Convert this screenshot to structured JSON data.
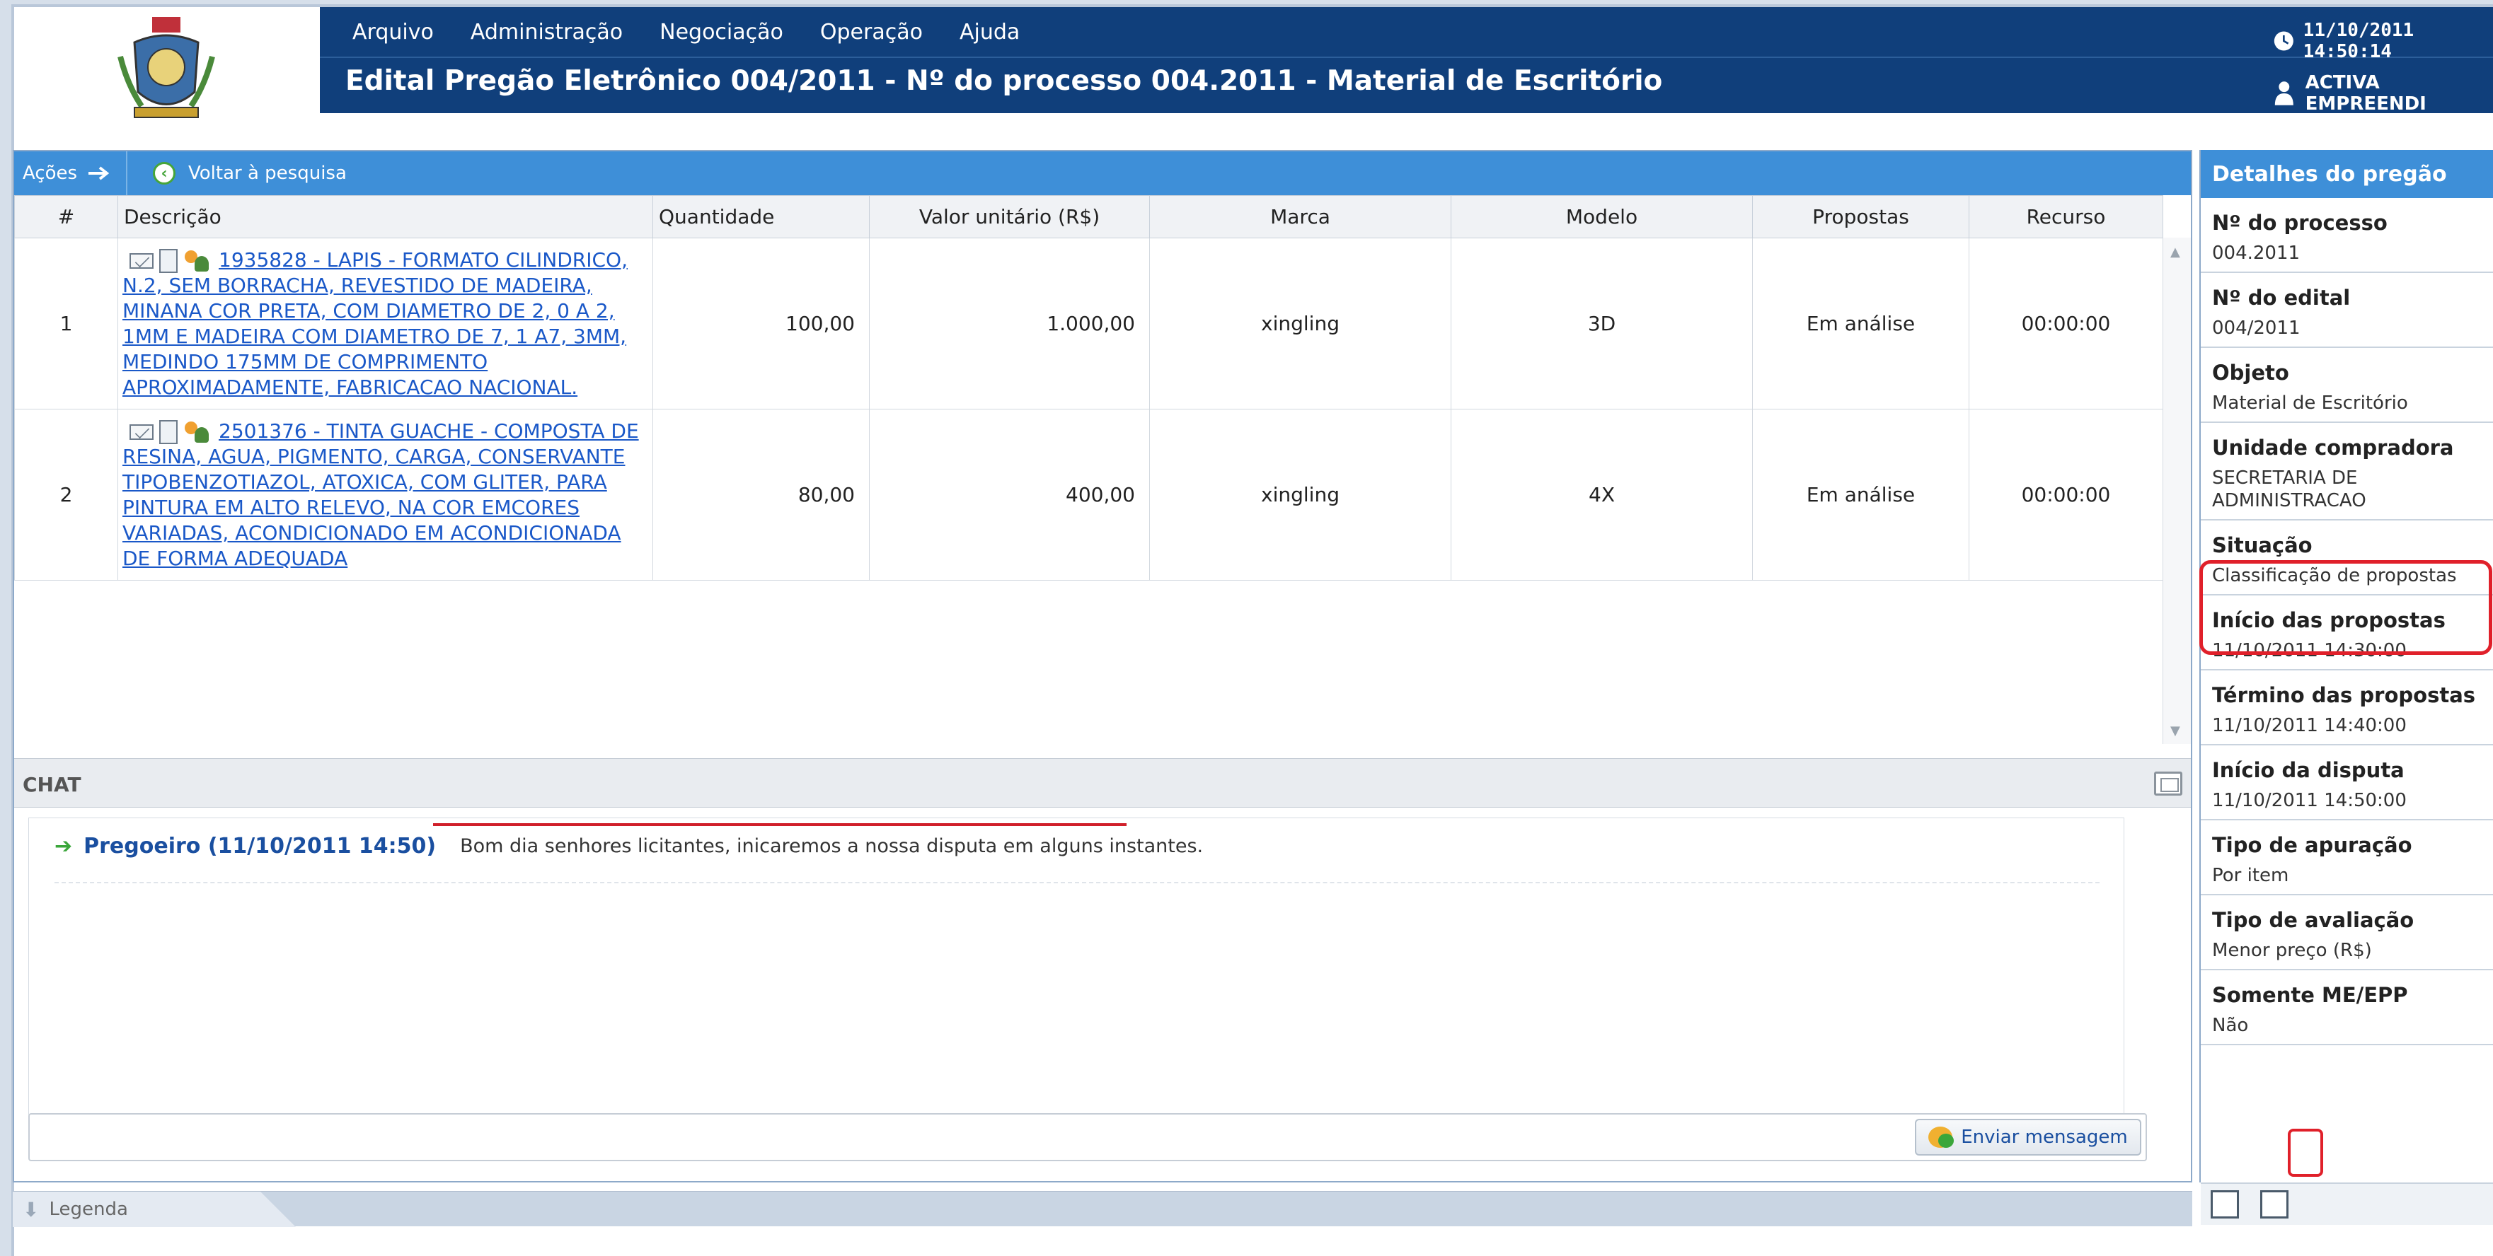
{
  "menu": [
    "Arquivo",
    "Administração",
    "Negociação",
    "Operação",
    "Ajuda"
  ],
  "header": {
    "title": "Edital Pregão Eletrônico 004/2011 - Nº do processo 004.2011 - Material de Escritório",
    "datetime": "11/10/2011 14:50:14",
    "user": "ACTIVA EMPREENDI"
  },
  "toolbar": {
    "acoes_label": "Ações",
    "voltar_label": "Voltar à pesquisa"
  },
  "table": {
    "columns": [
      "#",
      "Descrição",
      "Quantidade",
      "Valor unitário (R$)",
      "Marca",
      "Modelo",
      "Propostas",
      "Recurso"
    ],
    "rows": [
      {
        "num": "1",
        "descricao": "1935828 - LAPIS - FORMATO CILINDRICO, N.2, SEM BORRACHA, REVESTIDO DE MADEIRA, MINANA COR PRETA, COM DIAMETRO DE 2, 0 A 2, 1MM E MADEIRA COM DIAMETRO DE 7, 1 A7, 3MM, MEDINDO 175MM DE COMPRIMENTO APROXIMADAMENTE, FABRICACAO NACIONAL.",
        "quantidade": "100,00",
        "valor": "1.000,00",
        "marca": "xingling",
        "modelo": "3D",
        "propostas": "Em análise",
        "recurso": "00:00:00"
      },
      {
        "num": "2",
        "descricao": "2501376 - TINTA GUACHE - COMPOSTA DE RESINA, AGUA, PIGMENTO, CARGA, CONSERVANTE TIPOBENZOTIAZOL, ATOXICA, COM GLITER, PARA PINTURA EM ALTO RELEVO, NA COR EMCORES VARIADAS, ACONDICIONADO EM ACONDICIONADA DE FORMA ADEQUADA",
        "quantidade": "80,00",
        "valor": "400,00",
        "marca": "xingling",
        "modelo": "4X",
        "propostas": "Em análise",
        "recurso": "00:00:00"
      }
    ]
  },
  "chat": {
    "title": "CHAT",
    "message_sender": "Pregoeiro (11/10/2011 14:50)",
    "message_text": "Bom dia senhores licitantes, inicaremos a nossa disputa em alguns instantes.",
    "send_label": "Enviar mensagem"
  },
  "legend_label": "Legenda",
  "details": {
    "title": "Detalhes do pregão",
    "items": [
      {
        "label": "Nº do processo",
        "value": "004.2011"
      },
      {
        "label": "Nº do edital",
        "value": "004/2011"
      },
      {
        "label": "Objeto",
        "value": "Material de Escritório"
      },
      {
        "label": "Unidade compradora",
        "value": "SECRETARIA DE ADMINISTRACAO"
      },
      {
        "label": "Situação",
        "value": "Classificação de propostas"
      },
      {
        "label": "Início das propostas",
        "value": "11/10/2011 14:30:00"
      },
      {
        "label": "Término das propostas",
        "value": "11/10/2011 14:40:00"
      },
      {
        "label": "Início da disputa",
        "value": "11/10/2011 14:50:00"
      },
      {
        "label": "Tipo de apuração",
        "value": "Por item"
      },
      {
        "label": "Tipo de avaliação",
        "value": "Menor preço (R$)"
      },
      {
        "label": "Somente ME/EPP",
        "value": "Não"
      }
    ]
  },
  "colors": {
    "header_bg": "#103f7b",
    "toolbar_bg": "#3e8fd8",
    "link": "#1a58c8",
    "highlight": "#e0202a"
  }
}
